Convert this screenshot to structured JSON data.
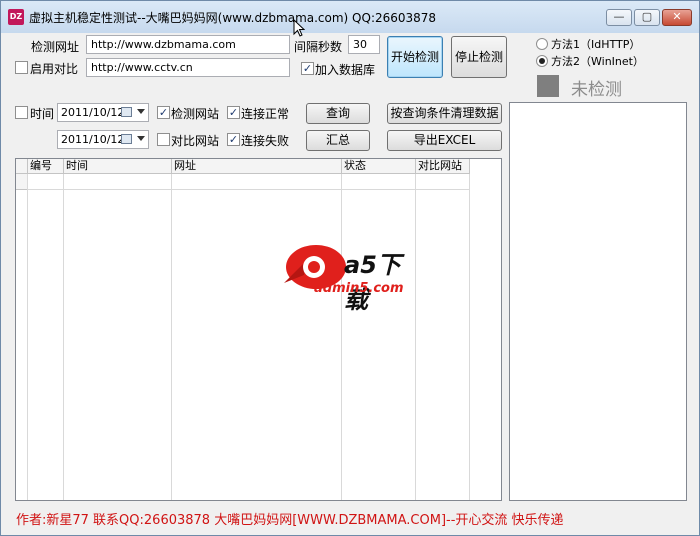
{
  "window": {
    "title": "虚拟主机稳定性测试--大嘴巴妈妈网(www.dzbmama.com)  QQ:26603878",
    "icon_text": "DZ",
    "min_symbol": "—",
    "max_symbol": "▢",
    "close_symbol": "✕"
  },
  "form": {
    "url_label": "检测网址",
    "url_value": "http://www.dzbmama.com",
    "interval_label": "间隔秒数",
    "interval_value": "30",
    "compare_label": "启用对比",
    "compare_value": "http://www.cctv.cn",
    "add_db_label": "加入数据库",
    "start_button": "开始检测",
    "stop_button": "停止检测"
  },
  "methods": {
    "method1": "方法1（IdHTTP）",
    "method2": "方法2（WinInet）",
    "status_text": "未检测"
  },
  "filters": {
    "time_label": "时间",
    "date_from": "2011/10/12",
    "date_to": "2011/10/12",
    "check_site_label": "检测网站",
    "compare_site_label": "对比网站",
    "conn_ok_label": "连接正常",
    "conn_fail_label": "连接失败",
    "query_button": "查询",
    "summary_button": "汇总",
    "clear_button": "按查询条件清理数据",
    "export_button": "导出EXCEL"
  },
  "grid": {
    "columns": [
      "编号",
      "时间",
      "网址",
      "状态",
      "对比网站"
    ]
  },
  "watermark": {
    "brand": "a5下载",
    "site": "admin5.com"
  },
  "footer": {
    "text": "作者:新星77   联系QQ:26603878    大嘴巴妈妈网[WWW.DZBMAMA.COM]--开心交流 快乐传递"
  },
  "colors": {
    "footer_text": "#d01414",
    "watermark_red": "#e0201c",
    "status_square": "#7f7f7f"
  }
}
